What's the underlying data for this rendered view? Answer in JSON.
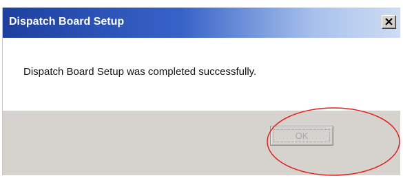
{
  "dialog": {
    "title": "Dispatch Board Setup",
    "close_icon": "close-icon",
    "message": "Dispatch Board Setup was completed successfully.",
    "ok_label": "OK"
  },
  "colors": {
    "titlebar_start": "#1e3f9e",
    "titlebar_end": "#cfdcf3",
    "annotation": "#e02020",
    "dialog_face": "#d6d3ce"
  }
}
